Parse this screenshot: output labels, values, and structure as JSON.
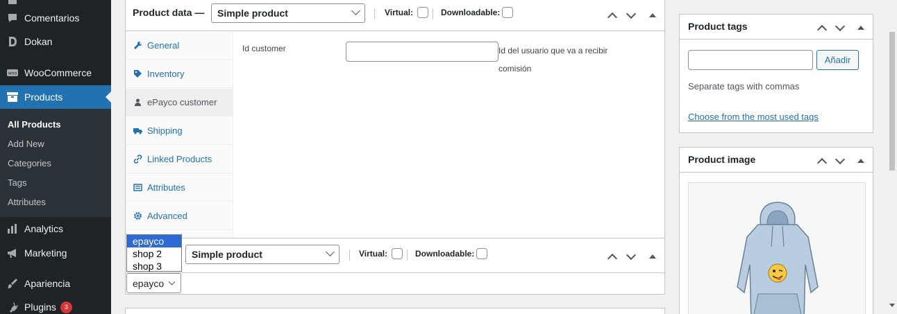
{
  "sidebar": {
    "items": [
      {
        "label": "Comentarios",
        "icon": "comment-icon"
      },
      {
        "label": "Dokan",
        "icon": "dokan-icon"
      },
      {
        "label": "WooCommerce",
        "icon": "woocommerce-icon"
      },
      {
        "label": "Products",
        "icon": "archive-icon"
      },
      {
        "label": "Analytics",
        "icon": "bar-chart-icon"
      },
      {
        "label": "Marketing",
        "icon": "megaphone-icon"
      },
      {
        "label": "Apariencia",
        "icon": "brush-icon"
      },
      {
        "label": "Plugins",
        "icon": "plug-icon",
        "badge": "3"
      }
    ],
    "submenu": [
      "All Products",
      "Add New",
      "Categories",
      "Tags",
      "Attributes"
    ]
  },
  "product_data": {
    "title": "Product data —",
    "type_select": "Simple product",
    "virtual_label": "Virtual:",
    "downloadable_label": "Downloadable:",
    "tabs": [
      {
        "label": "General",
        "icon": "wrench-icon"
      },
      {
        "label": "Inventory",
        "icon": "tag-icon"
      },
      {
        "label": "ePayco customer",
        "icon": "user-icon"
      },
      {
        "label": "Shipping",
        "icon": "truck-icon"
      },
      {
        "label": "Linked Products",
        "icon": "link-icon"
      },
      {
        "label": "Attributes",
        "icon": "list-icon"
      },
      {
        "label": "Advanced",
        "icon": "gear-icon"
      }
    ],
    "field_label": "Id customer",
    "field_value": "",
    "field_description": "Id del usuario que va a recibir comisión"
  },
  "product_data_2": {
    "type_select": "Simple product",
    "virtual_label": "Virtual:",
    "downloadable_label": "Downloadable:",
    "shop_select": "epayco",
    "shop_options": [
      "epayco",
      "shop 2",
      "shop 3"
    ]
  },
  "tags_box": {
    "title": "Product tags",
    "input_value": "",
    "button": "Añadir",
    "hint": "Separate tags with commas",
    "link": "Choose from the most used tags"
  },
  "image_box": {
    "title": "Product image"
  },
  "colors": {
    "sidebar_bg": "#1d2327",
    "accent": "#2271b1",
    "badge": "#d63638"
  }
}
